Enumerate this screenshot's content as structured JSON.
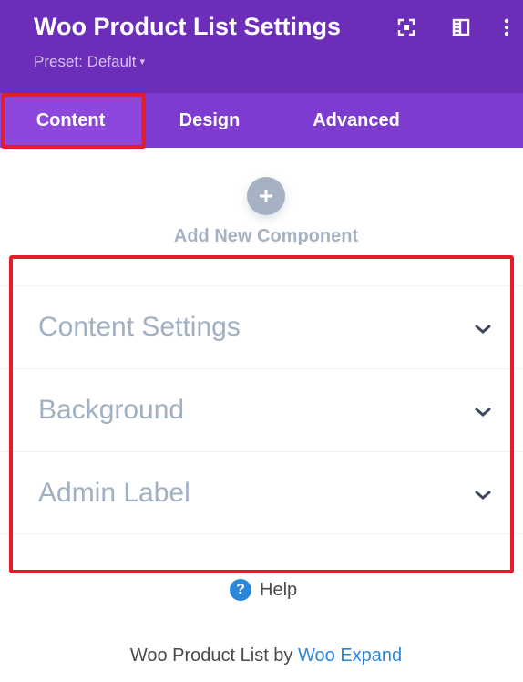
{
  "header": {
    "title": "Woo Product List Settings",
    "preset_label": "Preset: Default",
    "preset_caret": "▾",
    "icons": [
      "focus-icon",
      "sidebar-toggle-icon",
      "more-options-icon"
    ],
    "background_color": "#6c2eb9"
  },
  "tabs": [
    {
      "label": "Content",
      "active": true
    },
    {
      "label": "Design",
      "active": false
    },
    {
      "label": "Advanced",
      "active": false
    }
  ],
  "add_component": {
    "icon": "plus-icon",
    "label": "Add New Component"
  },
  "accordion": [
    {
      "label": "Content Settings",
      "icon": "chevron-down-icon"
    },
    {
      "label": "Background",
      "icon": "chevron-down-icon"
    },
    {
      "label": "Admin Label",
      "icon": "chevron-down-icon"
    }
  ],
  "help": {
    "icon_glyph": "?",
    "label": "Help"
  },
  "footer": {
    "text_prefix": "Woo Product List by",
    "link_text": "Woo Expand"
  },
  "colors": {
    "accent": "#6c2eb9",
    "tab_bar": "#7e3bd0",
    "highlight_box": "#e51d2a",
    "link": "#2b87da"
  }
}
